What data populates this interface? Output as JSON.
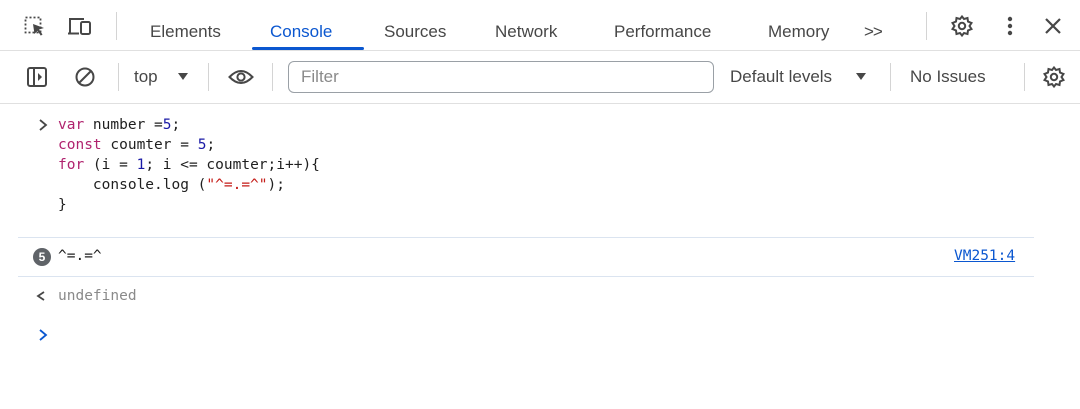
{
  "tabs": {
    "elements": "Elements",
    "console": "Console",
    "sources": "Sources",
    "network": "Network",
    "performance": "Performance",
    "memory": "Memory",
    "more": ">>"
  },
  "toolbar": {
    "context": "top",
    "filter_placeholder": "Filter",
    "levels": "Default levels",
    "issues": "No Issues"
  },
  "console": {
    "input_lines": [
      {
        "parts": [
          {
            "t": "var ",
            "c": "kw"
          },
          {
            "t": "number ",
            "c": "plain"
          },
          {
            "t": "=",
            "c": "plain"
          },
          {
            "t": "5",
            "c": "num"
          },
          {
            "t": ";",
            "c": "plain"
          }
        ]
      },
      {
        "parts": [
          {
            "t": "const ",
            "c": "kw"
          },
          {
            "t": "coumter ",
            "c": "plain"
          },
          {
            "t": "= ",
            "c": "plain"
          },
          {
            "t": "5",
            "c": "num"
          },
          {
            "t": ";",
            "c": "plain"
          }
        ]
      },
      {
        "parts": [
          {
            "t": "for ",
            "c": "kw"
          },
          {
            "t": "(i = ",
            "c": "plain"
          },
          {
            "t": "1",
            "c": "num"
          },
          {
            "t": "; i <= coumter;i++){",
            "c": "plain"
          }
        ]
      },
      {
        "parts": [
          {
            "t": "    console.log (",
            "c": "plain"
          },
          {
            "t": "\"^=.=^\"",
            "c": "str"
          },
          {
            "t": ");",
            "c": "plain"
          }
        ]
      },
      {
        "parts": [
          {
            "t": "}",
            "c": "plain"
          }
        ]
      }
    ],
    "log_count": "5",
    "log_message": "^=.=^",
    "log_source": "VM251:4",
    "result": "undefined"
  },
  "colors": {
    "accent": "#0b57d0",
    "keyword": "#b0236e",
    "number": "#1a1aa6",
    "string": "#c41a16"
  }
}
